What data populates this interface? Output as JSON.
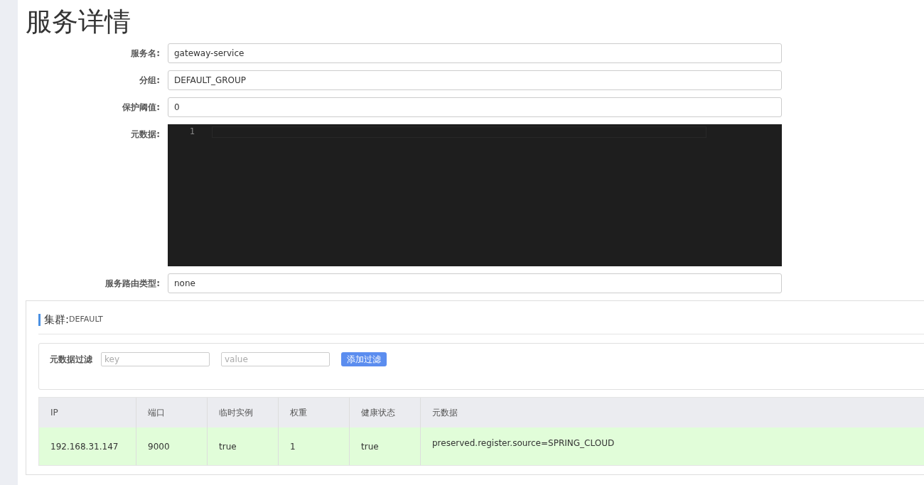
{
  "title": "服务详情",
  "fields": [
    {
      "label": "服务名:",
      "kind": "input",
      "value": "gateway-service"
    },
    {
      "label": "分组:",
      "kind": "input",
      "value": "DEFAULT_GROUP"
    },
    {
      "label": "保护阈值:",
      "kind": "input",
      "value": "0"
    },
    {
      "label": "元数据:",
      "kind": "editor",
      "line_numbers": [
        "1"
      ]
    },
    {
      "label": "服务路由类型:",
      "kind": "input",
      "value": "none"
    }
  ],
  "cluster": {
    "label": "集群:",
    "name": "DEFAULT",
    "filter": {
      "label": "元数据过滤",
      "key_placeholder": "key",
      "value_placeholder": "value",
      "button": "添加过滤"
    },
    "table": {
      "columns": [
        "IP",
        "端口",
        "临时实例",
        "权重",
        "健康状态",
        "元数据"
      ],
      "rows": [
        {
          "healthy": true,
          "cells": [
            "192.168.31.147",
            "9000",
            "true",
            "1",
            "true",
            "preserved.register.source=SPRING_CLOUD"
          ]
        }
      ]
    }
  }
}
